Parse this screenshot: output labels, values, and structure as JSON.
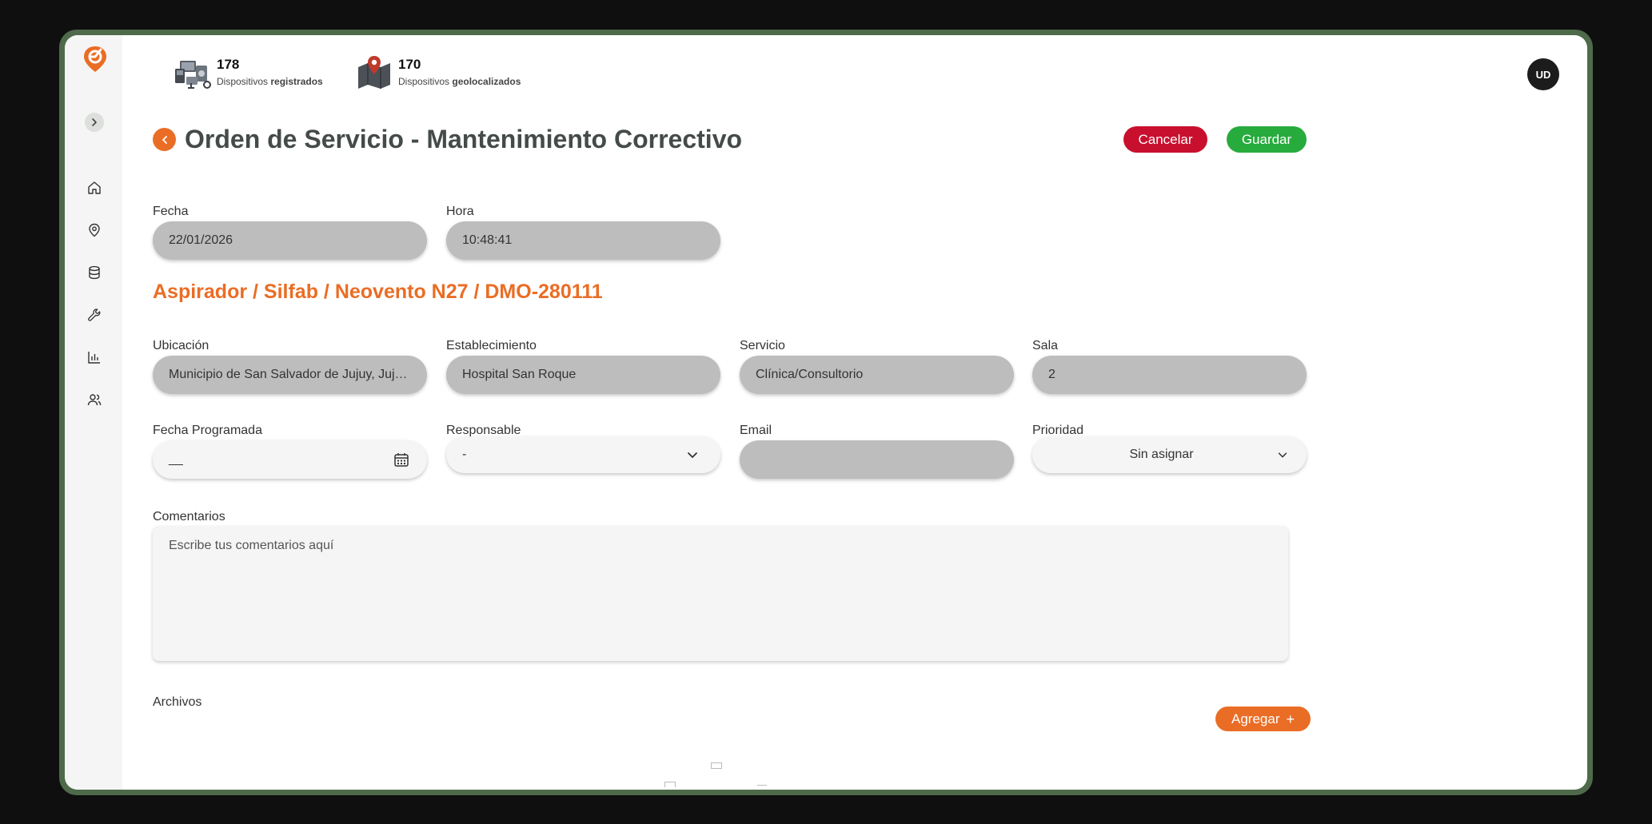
{
  "stats": [
    {
      "count": "178",
      "label_prefix": "Dispositivos ",
      "label_bold": "registrados",
      "icon": "devices-icon"
    },
    {
      "count": "170",
      "label_prefix": "Dispositivos ",
      "label_bold": "geolocalizados",
      "icon": "map-pin-icon"
    }
  ],
  "user": {
    "initials": "UD"
  },
  "sidebar": {
    "items": [
      {
        "name": "home",
        "icon": "home-icon"
      },
      {
        "name": "location",
        "icon": "map-pin-icon"
      },
      {
        "name": "database",
        "icon": "database-icon"
      },
      {
        "name": "maintenance",
        "icon": "wrench-icon"
      },
      {
        "name": "reports",
        "icon": "bar-chart-icon"
      },
      {
        "name": "users",
        "icon": "users-icon"
      }
    ]
  },
  "page": {
    "title": "Orden de Servicio - Mantenimiento Correctivo",
    "cancel_label": "Cancelar",
    "save_label": "Guardar"
  },
  "form": {
    "fecha": {
      "label": "Fecha",
      "value": "22/01/2026"
    },
    "hora": {
      "label": "Hora",
      "value": "10:48:41"
    },
    "device_title": "Aspirador / Silfab / Neovento N27 / DMO-280111",
    "ubicacion": {
      "label": "Ubicación",
      "value": "Municipio de San Salvador de Jujuy, Jujuy, Argentina"
    },
    "establecimiento": {
      "label": "Establecimiento",
      "value": "Hospital San Roque"
    },
    "servicio": {
      "label": "Servicio",
      "value": "Clínica/Consultorio"
    },
    "sala": {
      "label": "Sala",
      "value": "2"
    },
    "fecha_programada": {
      "label": "Fecha Programada",
      "value": "__"
    },
    "responsable": {
      "label": "Responsable",
      "value": "-"
    },
    "email": {
      "label": "Email",
      "value": ""
    },
    "prioridad": {
      "label": "Prioridad",
      "value": "Sin asignar"
    },
    "comentarios": {
      "label": "Comentarios",
      "placeholder": "Escribe tus comentarios aquí"
    },
    "archivos": {
      "label": "Archivos",
      "add_label": "Agregar"
    }
  },
  "colors": {
    "accent": "#ea6d25",
    "cancel": "#c8102e",
    "save": "#27ab3d",
    "frame": "#4e6a4a"
  }
}
